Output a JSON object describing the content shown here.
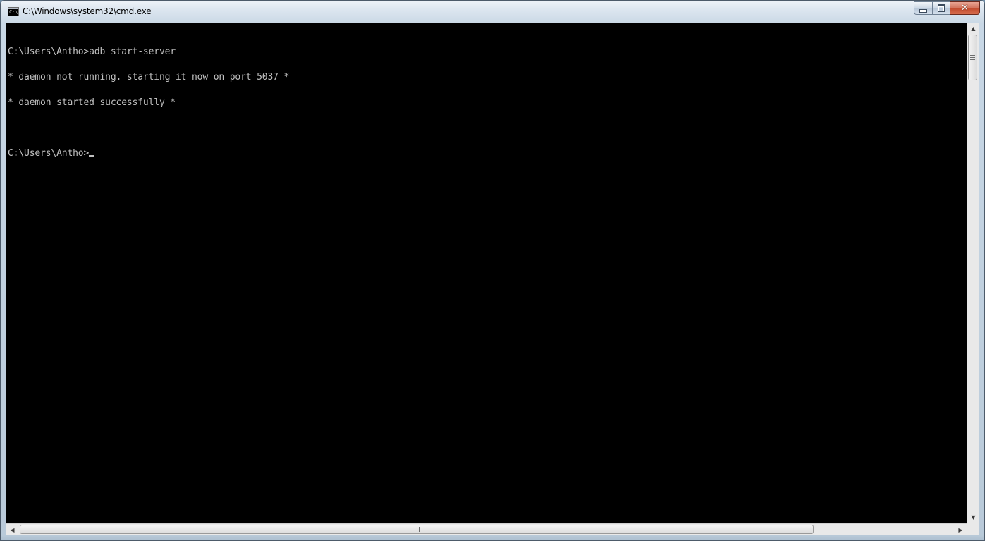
{
  "window": {
    "title": "C:\\Windows\\system32\\cmd.exe",
    "icon": "cmd-icon",
    "icon_text": "C:\\",
    "buttons": {
      "minimize": "minimize-icon",
      "maximize": "maximize-icon",
      "close": "close-icon"
    }
  },
  "console": {
    "lines": [
      "C:\\Users\\Antho>adb start-server",
      "* daemon not running. starting it now on port 5037 *",
      "* daemon started successfully *",
      ""
    ],
    "prompt": "C:\\Users\\Antho>",
    "text_color": "#c0c0c0",
    "background_color": "#000000"
  },
  "scrollbars": {
    "up_arrow": "▲",
    "down_arrow": "▼",
    "left_arrow": "◀",
    "right_arrow": "▶"
  }
}
